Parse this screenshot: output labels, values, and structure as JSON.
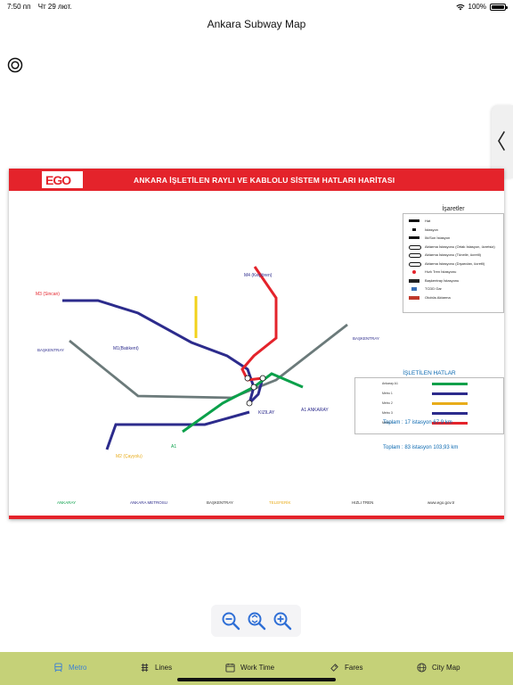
{
  "status_bar": {
    "time": "7:50 пп",
    "date": "Чт 29 лют.",
    "battery": "100%"
  },
  "nav": {
    "title": "Ankara Subway Map"
  },
  "map": {
    "header_title": "ANKARA İŞLETİLEN RAYLI VE KABLOLU SİSTEM HATLARI HARİTASI",
    "logo_text": "EGO",
    "line_labels": {
      "m1": "M1(Batıkent)",
      "m2": "M2 (Çayyolu)",
      "m3": "M3 (Sincan)",
      "m4": "M4 (Keçiören)",
      "a1": "A1",
      "kizilay": "KIZILAY",
      "baskentray_w": "BAŞKENTRAY",
      "baskentray_e": "BAŞKENTRAY",
      "ankaray": "A1 ANKARAY"
    },
    "legend": {
      "title": "İşaretler",
      "items": [
        "Hat",
        "İstasyon",
        "İlk/Son İstasyon",
        "Aktarma İstasyonu (Ortak İstasyon, ücretsiz)",
        "Aktarma İstasyonu (Tünelle, ücretli)",
        "Aktarma İstasyonu (Dışarıdan, ücretli)",
        "Hızlı Tren İstasyonu",
        "Başkentray İstasyonu",
        "TCDD Gar",
        "Otobüs Aktarma"
      ]
    },
    "lines_box": {
      "title": "İŞLETİLEN HATLAR",
      "rows": [
        {
          "name": "Ankaray A1",
          "color": "#0aa04a"
        },
        {
          "name": "Metro 1",
          "color": "#2c2b8c"
        },
        {
          "name": "Metro 2",
          "color": "#e8ac1a"
        },
        {
          "name": "Metro 3",
          "color": "#2c2b8c"
        },
        {
          "name": "Metro 4",
          "color": "#e4232b"
        }
      ],
      "totals_1": "Toplam : 17 istasyon   67,9 km",
      "totals_2": "Toplam : 83 istasyon   103,93 km"
    },
    "bottom_legend": {
      "ankaray": "ANKARAY",
      "metro": "ANKARA METROSU",
      "baskentray": "BAŞKENTRAY",
      "teleferik": "TELEFERİK",
      "yht": "HIZLI TREN",
      "web": "www.ego.gov.tr"
    }
  },
  "tabs": [
    {
      "label": "Metro",
      "icon": "train-icon",
      "active": true
    },
    {
      "label": "Lines",
      "icon": "lines-icon",
      "active": false
    },
    {
      "label": "Work Time",
      "icon": "calendar-icon",
      "active": false
    },
    {
      "label": "Fares",
      "icon": "ticket-icon",
      "active": false
    },
    {
      "label": "City Map",
      "icon": "globe-icon",
      "active": false
    }
  ],
  "colors": {
    "tab_bar": "#c5d178",
    "active_tab": "#3a7fd5",
    "ego_red": "#e4232b",
    "metro_blue": "#2c2b8c",
    "ankaray_green": "#0aa04a",
    "teleferik_yellow": "#f2d21b",
    "baskentray_gray": "#6b7a7a",
    "zoom_blue": "#2f6fd6"
  }
}
